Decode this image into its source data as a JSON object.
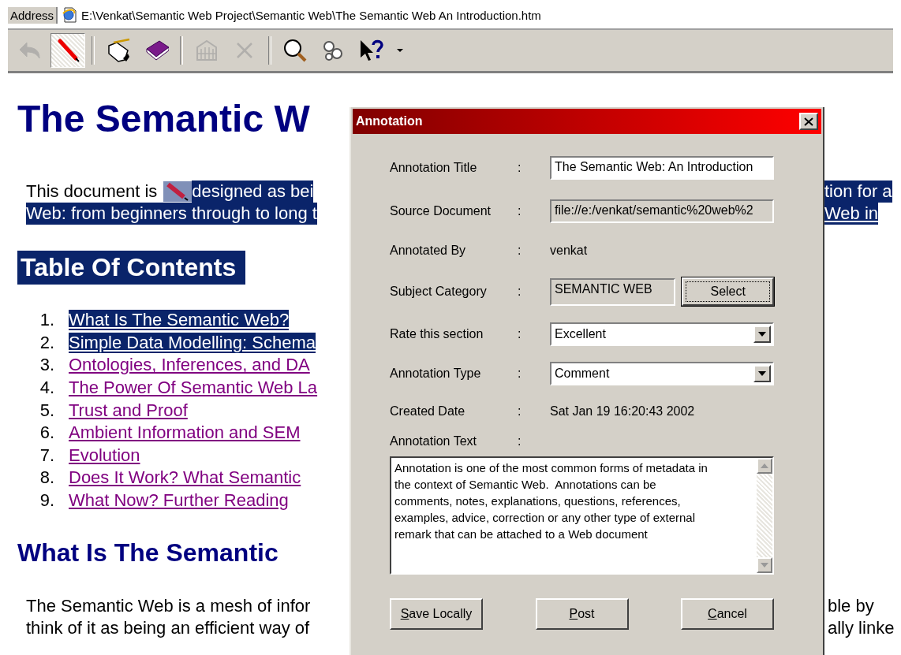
{
  "address_bar": {
    "label": "Address",
    "value": "E:\\Venkat\\Semantic Web Project\\Semantic Web\\The Semantic Web An Introduction.htm"
  },
  "toolbar": [
    {
      "kind": "back",
      "disabled": true,
      "pressed": false
    },
    {
      "kind": "highlighter",
      "disabled": false,
      "pressed": true
    },
    {
      "kind": "separator"
    },
    {
      "kind": "annotate",
      "disabled": false,
      "pressed": false
    },
    {
      "kind": "book",
      "disabled": false,
      "pressed": false
    },
    {
      "kind": "separator"
    },
    {
      "kind": "archive",
      "disabled": true,
      "pressed": false
    },
    {
      "kind": "delete",
      "disabled": true,
      "pressed": false
    },
    {
      "kind": "separator"
    },
    {
      "kind": "search",
      "disabled": false,
      "pressed": false
    },
    {
      "kind": "links",
      "disabled": false,
      "pressed": false
    },
    {
      "kind": "help",
      "disabled": false,
      "pressed": false
    }
  ],
  "page": {
    "title": "The Semantic W",
    "intro": [
      [
        {
          "kind": "text",
          "text": "This document is",
          "selected": false
        },
        {
          "kind": "marker",
          "selected": true
        },
        {
          "kind": "text",
          "text": "designed as bei",
          "selected": true
        }
      ],
      [
        {
          "kind": "text",
          "text": "Web: from beginners through to long t",
          "selected": true
        }
      ]
    ],
    "toc_heading": {
      "text": "Table Of Contents",
      "selected": true
    },
    "toc": [
      {
        "number": "1.",
        "text": "What Is The Semantic Web?",
        "selected": true
      },
      {
        "number": "2.",
        "text": "Simple Data Modelling: Schema",
        "selected": true
      },
      {
        "number": "3.",
        "text": "Ontologies, Inferences, and DA",
        "selected": false
      },
      {
        "number": "4.",
        "text": "The Power Of Semantic Web La",
        "selected": false
      },
      {
        "number": "5.",
        "text": "Trust and Proof",
        "selected": false
      },
      {
        "number": "6.",
        "text": "Ambient Information and SEM",
        "selected": false
      },
      {
        "number": "7.",
        "text": "Evolution",
        "selected": false
      },
      {
        "number": "8.",
        "text": "Does It Work? What Semantic",
        "selected": false
      },
      {
        "number": "9.",
        "text": "What Now? Further Reading",
        "selected": false
      }
    ],
    "section_heading": "What Is The Semantic",
    "section_text": [
      "The Semantic Web is a mesh of infor",
      "think of it as being an efficient way of"
    ]
  },
  "page_right": {
    "intro": [
      {
        "text": "tion for a",
        "selected": true,
        "link": false
      },
      {
        "text": "Web in",
        "selected": true,
        "link": true
      }
    ],
    "section_text": [
      "ble by",
      "ally linke"
    ]
  },
  "dialog": {
    "title": "Annotation",
    "fields": [
      {
        "kind": "input",
        "label": "Annotation Title",
        "separator": ":",
        "value": "The Semantic Web: An Introduction",
        "readonly": false
      },
      {
        "kind": "input",
        "label": "Source Document",
        "separator": ":",
        "value": "file://e:/venkat/semantic%20web%2",
        "readonly": true
      },
      {
        "kind": "static",
        "label": "Annotated By",
        "separator": ":",
        "value": "venkat"
      },
      {
        "kind": "picker",
        "label": "Subject Category",
        "separator": ":",
        "value": "SEMANTIC WEB",
        "button": {
          "label": "Select",
          "focused": true
        }
      },
      {
        "kind": "dropdown",
        "label": "Rate this section",
        "separator": ":",
        "value": "Excellent"
      },
      {
        "kind": "dropdown",
        "label": "Annotation Type",
        "separator": ":",
        "value": "Comment"
      },
      {
        "kind": "static",
        "label": "Created Date",
        "separator": ":",
        "value": "Sat Jan 19 16:20:43 2002"
      },
      {
        "kind": "textarea",
        "label": "Annotation Text",
        "separator": ":",
        "value": "Annotation is one of the most common forms of metadata in the context of Semantic Web.  Annotations can be comments, notes, explanations, questions, references, examples, advice, correction or any other type of external remark that can be attached to a Web document"
      }
    ],
    "buttons": [
      {
        "label": "Save Locally"
      },
      {
        "label": "Post"
      },
      {
        "label": "Cancel"
      }
    ]
  }
}
